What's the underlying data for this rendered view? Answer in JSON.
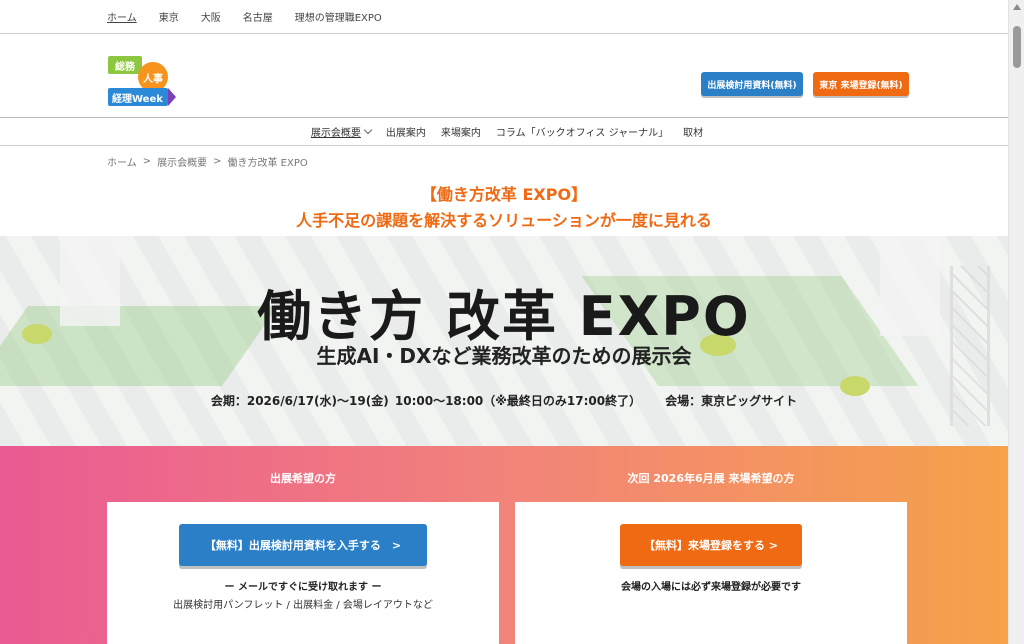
{
  "topbar": {
    "links": [
      "ホーム",
      "東京",
      "大阪",
      "名古屋",
      "理想の管理職EXPO"
    ]
  },
  "header": {
    "logo": {
      "line1": "総務",
      "circle": "人事",
      "line2": "経理Week"
    },
    "btn_materials": "出展検討用資料(無料)",
    "btn_register": "東京 来場登録(無料)"
  },
  "nav": {
    "items": [
      "展示会概要",
      "出展案内",
      "来場案内",
      "コラム「バックオフィス ジャーナル」",
      "取材"
    ]
  },
  "breadcrumb": {
    "home": "ホーム",
    "sep": ">",
    "level2": "展示会概要",
    "current": "働き方改革 EXPO"
  },
  "heading": {
    "line1": "【働き方改革 EXPO】",
    "line2": "人手不足の課題を解決するソリューションが一度に見れる"
  },
  "hero": {
    "title": "働き方 改革 EXPO",
    "subtitle": "生成AI・DXなど業務改革のための展示会",
    "date": "会期：2026/6/17(水)～19(金) 10:00～18:00（※最終日のみ17:00終了）",
    "venue": "会場：東京ビッグサイト"
  },
  "cta": {
    "exhibitor": {
      "title": "出展希望の方",
      "button": "【無料】出展検討用資料を入手する　>",
      "note": "ー メールですぐに受け取れます ー",
      "sub_note": "出展検討用パンフレット / 出展料金 / 会場レイアウトなど"
    },
    "visitor": {
      "title": "次回 2026年6月展  来場希望の方",
      "button": "【無料】来場登録をする >",
      "note": "会場の入場には必ず来場登録が必要です"
    }
  },
  "colors": {
    "accent_orange": "#ef6a13",
    "accent_blue": "#2b7fc6",
    "gradient_pink": "#ea5a93",
    "gradient_orange": "#f5a24a"
  }
}
